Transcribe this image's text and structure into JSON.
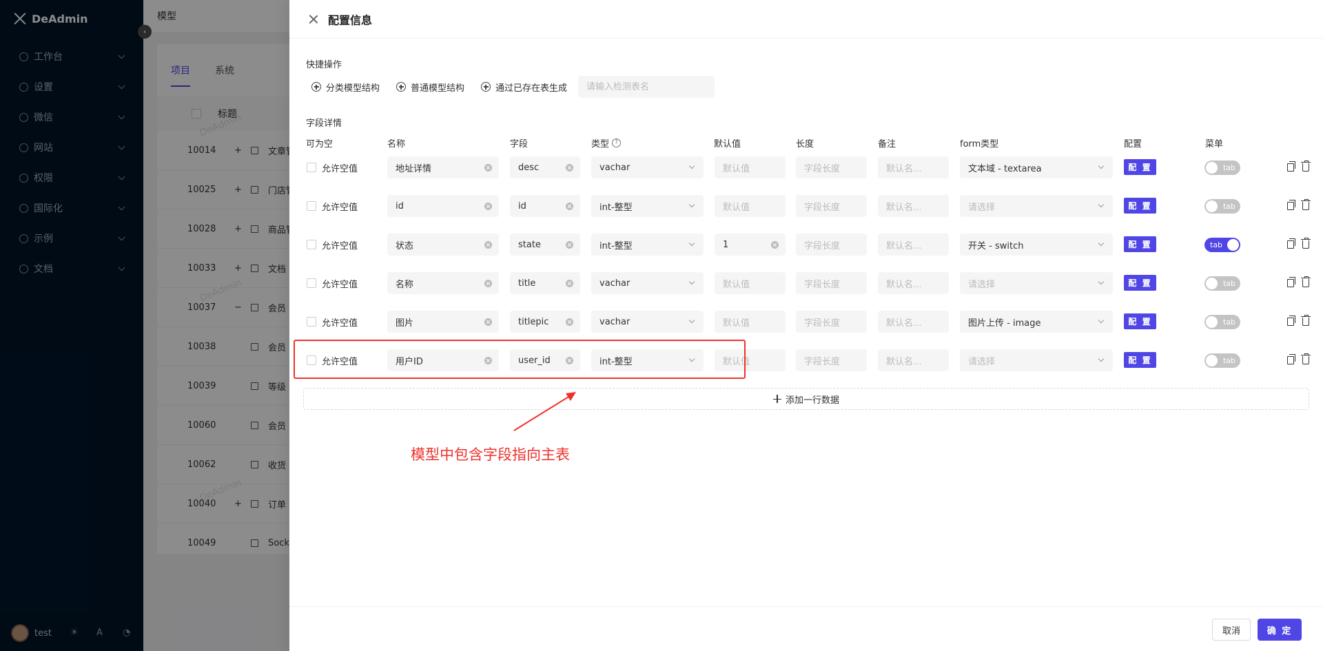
{
  "app": {
    "name": "DeAdmin"
  },
  "sidebar": {
    "items": [
      {
        "label": "工作台",
        "icon": "dashboard-icon"
      },
      {
        "label": "设置",
        "icon": "gear-icon"
      },
      {
        "label": "微信",
        "icon": "wechat-icon"
      },
      {
        "label": "网站",
        "icon": "globe-icon"
      },
      {
        "label": "权限",
        "icon": "lock-icon"
      },
      {
        "label": "国际化",
        "icon": "translate-icon"
      },
      {
        "label": "示例",
        "icon": "tag-icon"
      },
      {
        "label": "文档",
        "icon": "help-icon"
      }
    ],
    "user": "test"
  },
  "background": {
    "header_title": "模型",
    "tabs": [
      "项目",
      "系统"
    ],
    "table_head_title": "标题",
    "watermark": "DeAdmin",
    "rows": [
      {
        "id": "10014",
        "prefix": "+",
        "title": "文章管"
      },
      {
        "id": "10025",
        "prefix": "+",
        "title": "门店管"
      },
      {
        "id": "10028",
        "prefix": "+",
        "title": "商品管"
      },
      {
        "id": "10033",
        "prefix": "+",
        "title": "文档"
      },
      {
        "id": "10037",
        "prefix": "−",
        "title": "会员"
      },
      {
        "id": "10038",
        "prefix": "",
        "title": "会员"
      },
      {
        "id": "10039",
        "prefix": "",
        "title": "等级"
      },
      {
        "id": "10060",
        "prefix": "",
        "title": "会员"
      },
      {
        "id": "10062",
        "prefix": "",
        "title": "收货"
      },
      {
        "id": "10040",
        "prefix": "+",
        "title": "订单"
      },
      {
        "id": "10049",
        "prefix": "",
        "title": "Socke"
      }
    ]
  },
  "drawer": {
    "title": "配置信息",
    "quick_label": "快捷操作",
    "quick_actions": [
      "分类模型结构",
      "普通模型结构",
      "通过已存在表生成"
    ],
    "table_name_placeholder": "请输入检测表名",
    "field_label": "字段详情",
    "columns": [
      "可为空",
      "名称",
      "字段",
      "类型",
      "默认值",
      "长度",
      "备注",
      "form类型",
      "配置",
      "菜单"
    ],
    "nullable_label": "允许空值",
    "default_placeholder": "默认值",
    "length_placeholder": "字段长度",
    "remark_placeholder": "默认名...",
    "form_placeholder": "请选择",
    "config_label": "配 置",
    "toggle_label": "tab",
    "rows": [
      {
        "name": "地址详情",
        "field": "desc",
        "type": "vachar",
        "default": "",
        "form": "文本域 - textarea",
        "menu_on": false
      },
      {
        "name": "id",
        "field": "id",
        "type": "int-整型",
        "default": "",
        "form": "",
        "menu_on": false
      },
      {
        "name": "状态",
        "field": "state",
        "type": "int-整型",
        "default": "1",
        "form": "开关 - switch",
        "menu_on": true
      },
      {
        "name": "名称",
        "field": "title",
        "type": "vachar",
        "default": "",
        "form": "",
        "menu_on": false
      },
      {
        "name": "图片",
        "field": "titlepic",
        "type": "vachar",
        "default": "",
        "form": "图片上传 - image",
        "menu_on": false
      },
      {
        "name": "用户ID",
        "field": "user_id",
        "type": "int-整型",
        "default": "",
        "form": "",
        "menu_on": false
      }
    ],
    "add_row_label": "添加一行数据",
    "annotation": "模型中包含字段指向主表",
    "cancel_label": "取消",
    "ok_label": "确 定"
  },
  "colors": {
    "primary": "#4f46e5",
    "annotation": "#f0312b",
    "sidebar": "#001529"
  }
}
